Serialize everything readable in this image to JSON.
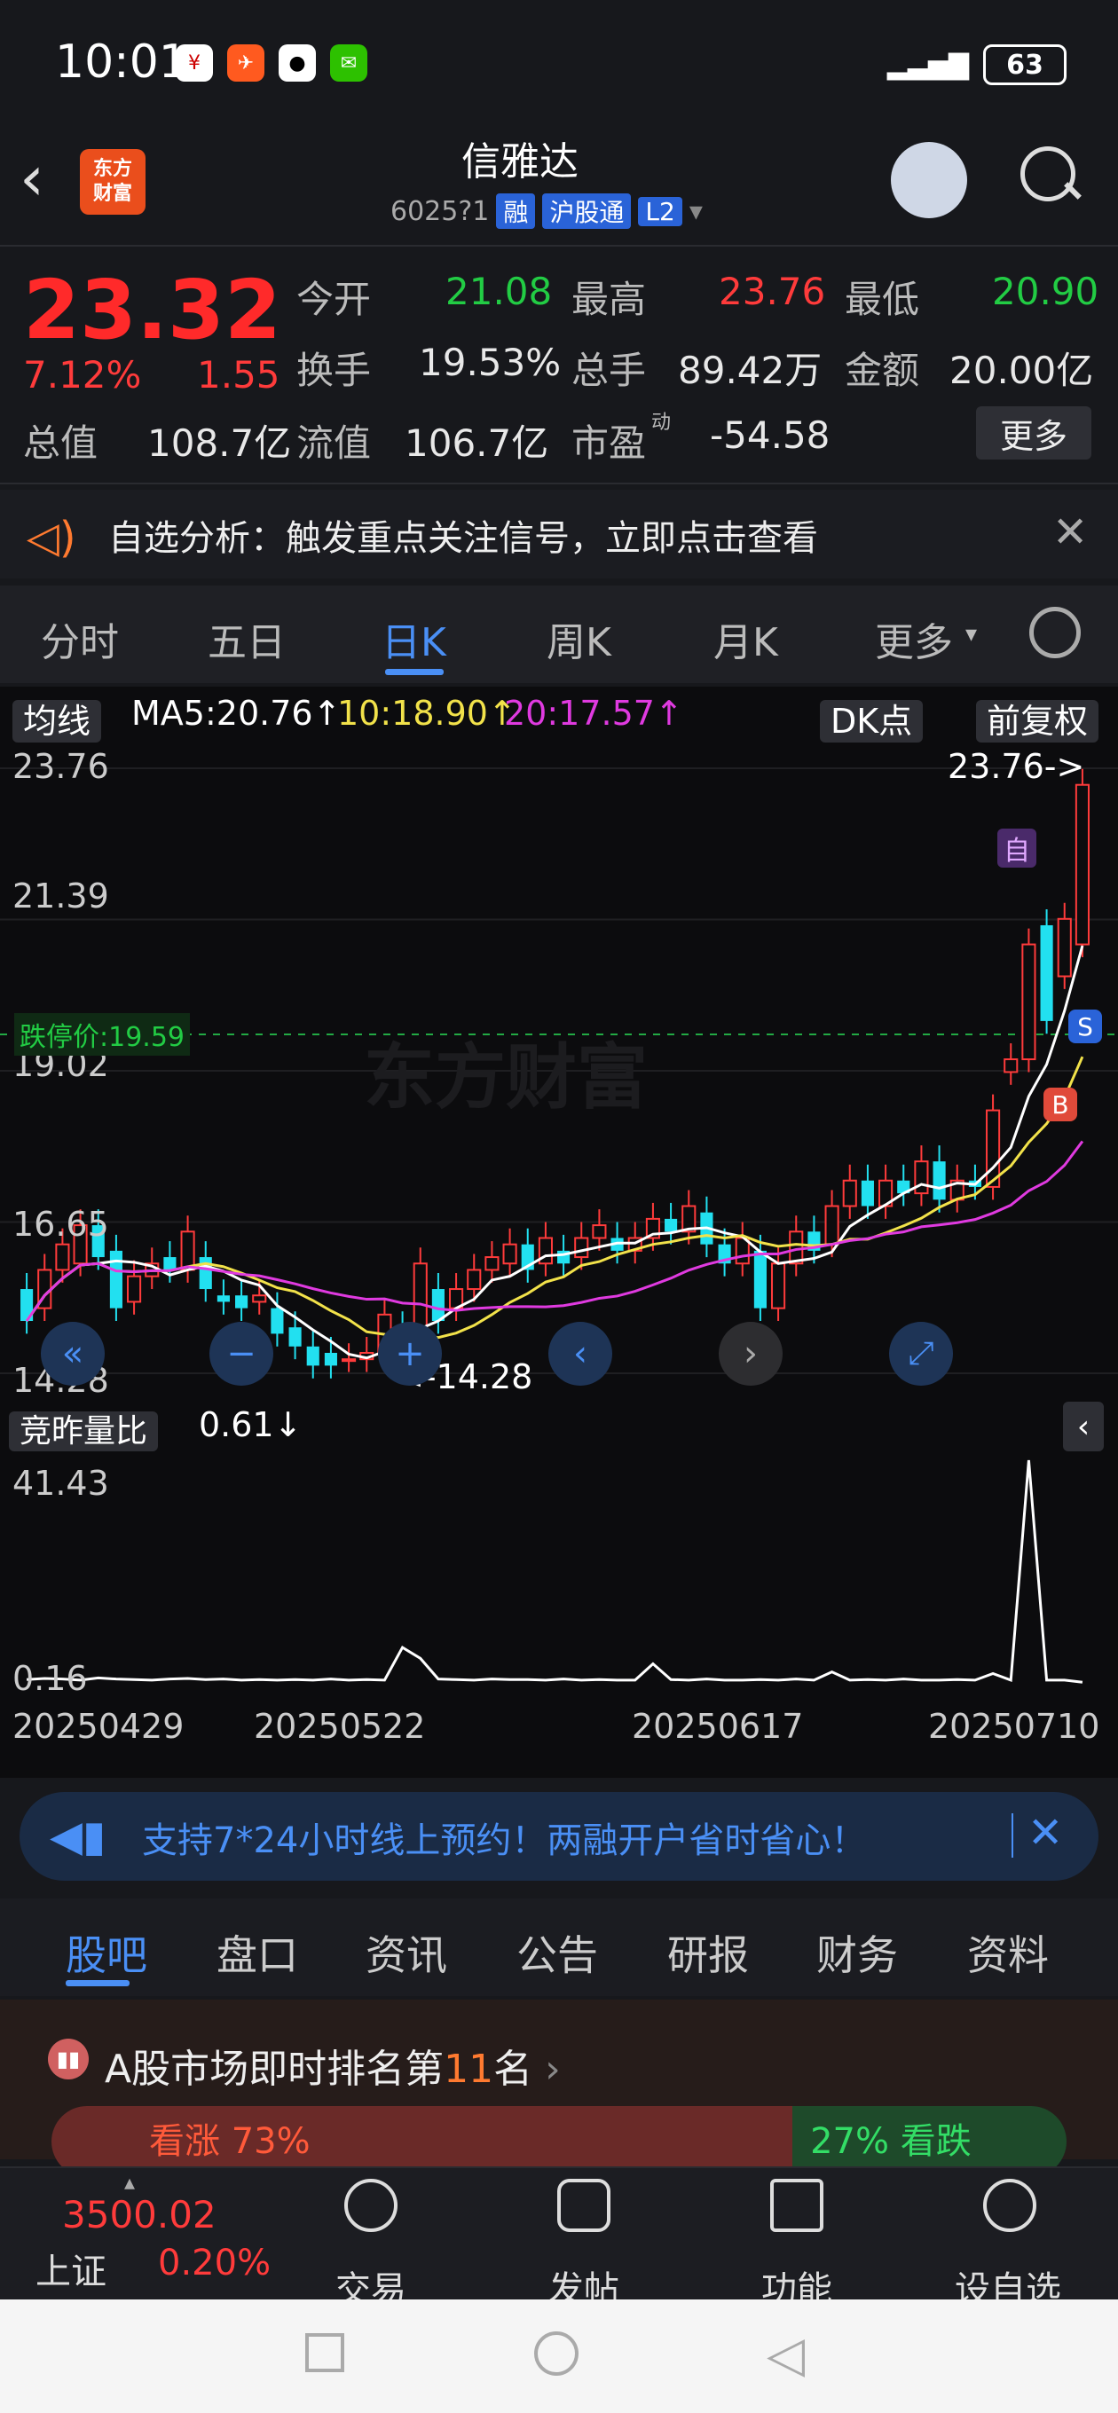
{
  "status_bar": {
    "time": "10:01",
    "battery": "63"
  },
  "header": {
    "logo_text": "东方财富",
    "stock_name": "信雅达",
    "stock_code": "6025?1",
    "tags": [
      "融",
      "沪股通",
      "L2"
    ]
  },
  "quote": {
    "price": "23.32",
    "change_pct": "7.12%",
    "change": "1.55",
    "rows": [
      [
        {
          "label": "今开",
          "value": "21.08",
          "color": "green"
        },
        {
          "label": "最高",
          "value": "23.76",
          "color": "red"
        },
        {
          "label": "最低",
          "value": "20.90",
          "color": "green"
        }
      ],
      [
        {
          "label": "换手",
          "value": "19.53%",
          "color": "white"
        },
        {
          "label": "总手",
          "value": "89.42万",
          "color": "white"
        },
        {
          "label": "金额",
          "value": "20.00亿",
          "color": "white"
        }
      ],
      [
        {
          "label": "总值",
          "value": "108.7亿",
          "color": "white"
        },
        {
          "label": "流值",
          "value": "106.7亿",
          "color": "white"
        },
        {
          "label": "市盈",
          "value": "-54.58",
          "color": "white"
        }
      ]
    ],
    "pe_superscript": "动",
    "more_button": "更多"
  },
  "alert": {
    "text": "自选分析：触发重点关注信号，立即点击查看"
  },
  "chart_tabs": [
    "分时",
    "五日",
    "日K",
    "周K",
    "月K",
    "更多"
  ],
  "active_chart_tab": "日K",
  "indicators": {
    "ma_button": "均线",
    "ma5": "MA5:20.76↑",
    "ma10": "10:18.90↑",
    "ma20": "20:17.57↑",
    "dk_button": "DK点",
    "adjust_button": "前复权"
  },
  "chart": {
    "y_ticks": [
      "23.76",
      "21.39",
      "19.02",
      "16.65",
      "14.28"
    ],
    "limit_down_label": "跌停价:19.59",
    "max_marker": "23.76->",
    "min_marker": "<-14.28",
    "self_badge": "自",
    "sell_badge": "S",
    "buy_badge": "B",
    "watermark": "东方财富"
  },
  "volume": {
    "label": "竞昨量比",
    "value": "0.61↓",
    "y_top": "41.43",
    "y_bottom": "0.16"
  },
  "x_dates": [
    "20250429",
    "20250522",
    "20250617",
    "20250710"
  ],
  "banner": {
    "text": "支持7*24小时线上预约！两融开户省时省心！"
  },
  "sub_tabs": [
    "股吧",
    "盘口",
    "资讯",
    "公告",
    "研报",
    "财务",
    "资料"
  ],
  "active_sub_tab": "股吧",
  "ranking": {
    "prefix": "A股市场即时排名第",
    "rank": "11",
    "suffix": "名",
    "bull": "看涨 73%",
    "bear": "27% 看跌"
  },
  "bottom_bar": {
    "index_value": "3500.02",
    "index_name": "上证",
    "index_change": "0.20%",
    "items": [
      "交易",
      "发帖",
      "功能",
      "设自选"
    ]
  },
  "chart_data": {
    "type": "candlestick",
    "ylim": [
      14.28,
      23.76
    ],
    "candles": [
      {
        "o": 15.6,
        "c": 15.1
      },
      {
        "o": 15.3,
        "c": 15.9
      },
      {
        "o": 15.9,
        "c": 16.3
      },
      {
        "o": 16.0,
        "c": 16.6
      },
      {
        "o": 16.6,
        "c": 16.1
      },
      {
        "o": 16.2,
        "c": 15.3
      },
      {
        "o": 15.4,
        "c": 15.8
      },
      {
        "o": 15.8,
        "c": 16.0
      },
      {
        "o": 16.1,
        "c": 15.9
      },
      {
        "o": 15.9,
        "c": 16.5
      },
      {
        "o": 16.1,
        "c": 15.6
      },
      {
        "o": 15.5,
        "c": 15.4
      },
      {
        "o": 15.5,
        "c": 15.3
      },
      {
        "o": 15.4,
        "c": 15.5
      },
      {
        "o": 15.3,
        "c": 14.9
      },
      {
        "o": 15.0,
        "c": 14.7
      },
      {
        "o": 14.7,
        "c": 14.4
      },
      {
        "o": 14.6,
        "c": 14.4
      },
      {
        "o": 14.5,
        "c": 14.5
      },
      {
        "o": 14.5,
        "c": 14.6
      },
      {
        "o": 14.6,
        "c": 15.2
      },
      {
        "o": 15.0,
        "c": 14.6
      },
      {
        "o": 14.6,
        "c": 16.0
      },
      {
        "o": 15.6,
        "c": 15.1
      },
      {
        "o": 15.3,
        "c": 15.6
      },
      {
        "o": 15.6,
        "c": 15.9
      },
      {
        "o": 15.9,
        "c": 16.1
      },
      {
        "o": 16.0,
        "c": 16.3
      },
      {
        "o": 16.3,
        "c": 15.9
      },
      {
        "o": 16.0,
        "c": 16.4
      },
      {
        "o": 16.2,
        "c": 16.0
      },
      {
        "o": 16.1,
        "c": 16.4
      },
      {
        "o": 16.4,
        "c": 16.6
      },
      {
        "o": 16.4,
        "c": 16.2
      },
      {
        "o": 16.2,
        "c": 16.4
      },
      {
        "o": 16.4,
        "c": 16.7
      },
      {
        "o": 16.7,
        "c": 16.5
      },
      {
        "o": 16.5,
        "c": 16.9
      },
      {
        "o": 16.8,
        "c": 16.3
      },
      {
        "o": 16.3,
        "c": 16.0
      },
      {
        "o": 16.0,
        "c": 16.4
      },
      {
        "o": 16.2,
        "c": 15.3
      },
      {
        "o": 15.3,
        "c": 16.0
      },
      {
        "o": 16.0,
        "c": 16.5
      },
      {
        "o": 16.5,
        "c": 16.2
      },
      {
        "o": 16.3,
        "c": 16.9
      },
      {
        "o": 16.9,
        "c": 17.3
      },
      {
        "o": 17.3,
        "c": 16.9
      },
      {
        "o": 16.9,
        "c": 17.3
      },
      {
        "o": 17.3,
        "c": 17.1
      },
      {
        "o": 17.1,
        "c": 17.6
      },
      {
        "o": 17.6,
        "c": 17.0
      },
      {
        "o": 17.0,
        "c": 17.3
      },
      {
        "o": 17.3,
        "c": 17.2
      },
      {
        "o": 17.2,
        "c": 18.4
      },
      {
        "o": 19.0,
        "c": 19.2
      },
      {
        "o": 19.2,
        "c": 21.0
      },
      {
        "o": 21.3,
        "c": 19.8
      },
      {
        "o": 20.5,
        "c": 21.4
      },
      {
        "o": 21.0,
        "c": 23.5
      }
    ],
    "volume_ratio": [
      1.1,
      1.3,
      1.2,
      1.0,
      1.4,
      1.2,
      1.1,
      1.0,
      1.2,
      1.3,
      1.1,
      1.2,
      1.0,
      1.1,
      1.0,
      1.1,
      1.0,
      1.2,
      1.0,
      1.1,
      1.0,
      7.0,
      5.0,
      1.2,
      1.1,
      1.0,
      1.2,
      1.1,
      1.1,
      1.0,
      1.2,
      1.0,
      1.1,
      1.0,
      1.0,
      4.0,
      1.1,
      1.0,
      1.2,
      1.0,
      1.0,
      1.1,
      1.0,
      1.2,
      1.0,
      2.5,
      1.0,
      1.1,
      1.0,
      1.2,
      1.0,
      1.0,
      1.1,
      1.0,
      2.2,
      1.0,
      41.43,
      1.0,
      1.0,
      0.61
    ]
  }
}
